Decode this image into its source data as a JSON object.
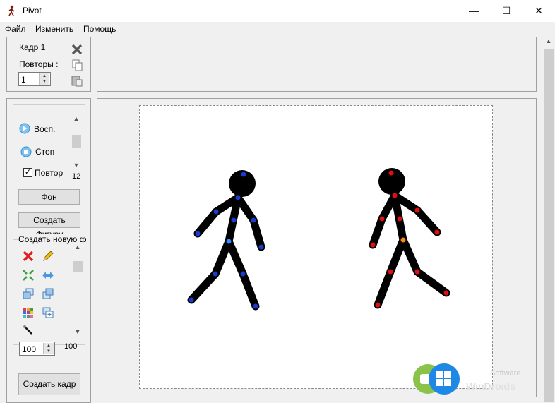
{
  "window": {
    "title": "Pivot",
    "min_glyph": "—",
    "max_glyph": "☐",
    "close_glyph": "✕"
  },
  "menu": [
    "Файл",
    "Изменить",
    "Помощь"
  ],
  "frame_panel": {
    "frame_label": "Кадр 1",
    "repeats_label": "Повторы :",
    "repeats_value": "1",
    "icons": [
      "delete-frame-icon",
      "copy-frame-icon",
      "paste-frame-icon"
    ]
  },
  "playback": {
    "play_label": "Восп.",
    "stop_label": "Стоп",
    "loop_label": "Повтор",
    "loop_checked": true,
    "speed_value": "12"
  },
  "buttons": {
    "background": "Фон",
    "create_figure": "Создать Фигуру",
    "create_frame": "Создать кадр"
  },
  "figure_tools": {
    "section_label": "Создать новую ф",
    "icons": [
      "delete-figure-icon",
      "edit-figure-icon",
      "scale-figure-icon",
      "flip-figure-icon",
      "front-icon",
      "back-icon",
      "color-icon",
      "add-figure-icon",
      "pick-icon"
    ],
    "scale_value": "100",
    "scale_slider_value": "100"
  },
  "watermark": {
    "top": "Software",
    "bottom": "WinDroids"
  },
  "colors": {
    "joint_blue": "#1a3ccc",
    "joint_red": "#e01010",
    "joint_orange": "#ff8a00",
    "joint_center_blue": "#2d8cff",
    "stick": "#000000"
  }
}
